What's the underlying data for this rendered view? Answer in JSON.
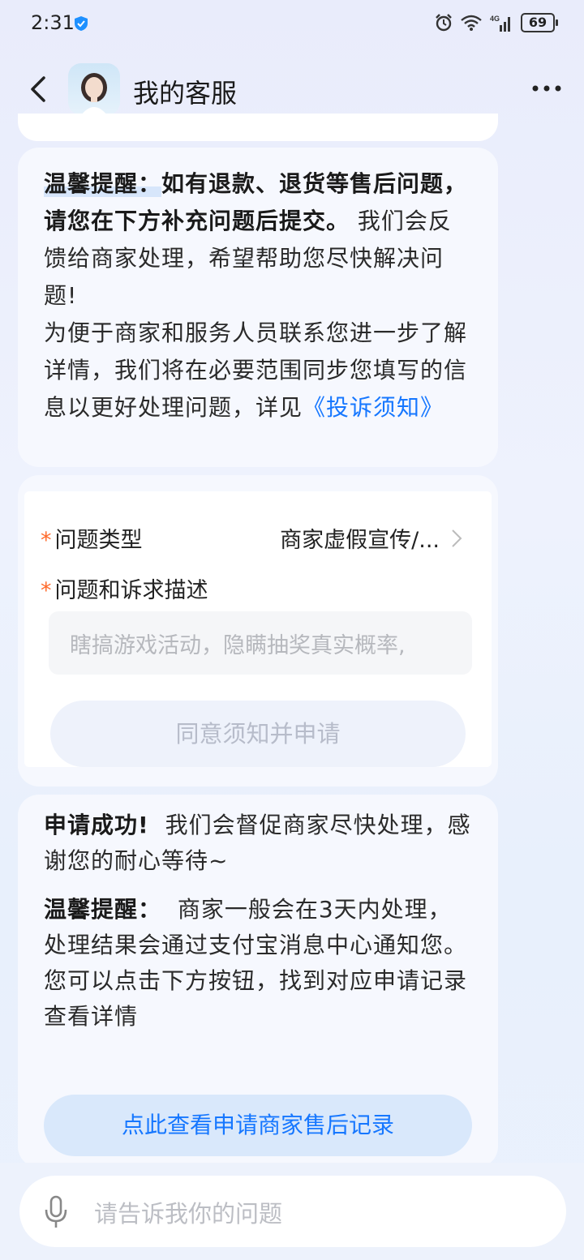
{
  "status_bar": {
    "time": "2:31",
    "battery": "69",
    "network": "4G"
  },
  "header": {
    "title": "我的客服"
  },
  "notice": {
    "label": "温馨提醒：",
    "bold_text": "如有退款、退货等售后问题，请您在下方补充问题后提交。",
    "text1": "我们会反馈给商家处理，希望帮助您尽快解决问题!",
    "text2": "为便于商家和服务人员联系您进一步了解详情，我们将在必要范围同步您填写的信息以更好处理问题，详见",
    "link": "《投诉须知》"
  },
  "form": {
    "type_label": "问题类型",
    "type_value": "商家虚假宣传/...",
    "desc_label": "问题和诉求描述",
    "desc_placeholder": "瞎搞游戏活动，隐瞒抽奖真实概率,",
    "submit_label": "同意须知并申请",
    "required_mark": "*"
  },
  "success": {
    "title": "申请成功!",
    "text1": "我们会督促商家尽快处理，感谢您的耐心等待~",
    "label2": "温馨提醒：",
    "text2": "商家一般会在3天内处理，处理结果会通过支付宝消息中心通知您。",
    "text3": "您可以点击下方按钮，找到对应申请记录查看详情",
    "button_label": "点此查看申请商家售后记录"
  },
  "input": {
    "placeholder": "请告诉我你的问题"
  },
  "colors": {
    "accent": "#1677ff",
    "required": "#ff6a2a"
  }
}
